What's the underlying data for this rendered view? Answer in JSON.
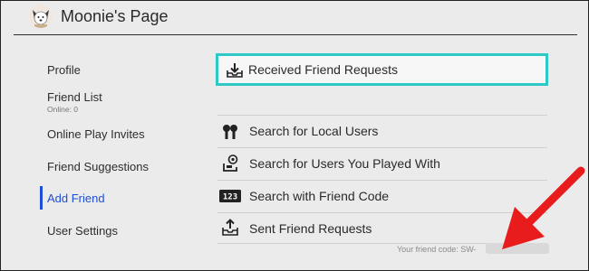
{
  "header": {
    "title": "Moonie's Page"
  },
  "sidebar": {
    "items": [
      {
        "label": "Profile"
      },
      {
        "label": "Friend List",
        "sub": "Online: 0"
      },
      {
        "label": "Online Play Invites"
      },
      {
        "label": "Friend Suggestions"
      },
      {
        "label": "Add Friend"
      },
      {
        "label": "User Settings"
      }
    ]
  },
  "main": {
    "received": {
      "label": "Received Friend Requests",
      "icon": "inbox-download-icon"
    },
    "options": [
      {
        "label": "Search for Local Users",
        "icon": "local-users-icon"
      },
      {
        "label": "Search for Users You Played With",
        "icon": "played-with-users-icon"
      },
      {
        "label": "Search with Friend Code",
        "icon": "friend-code-123-icon"
      },
      {
        "label": "Sent Friend Requests",
        "icon": "outbox-upload-icon"
      }
    ],
    "friend_code": "Your friend code: SW-"
  },
  "colors": {
    "accent_teal": "#2ec9c7",
    "active_blue": "#1e4fd8",
    "arrow_red": "#e81c1c"
  }
}
